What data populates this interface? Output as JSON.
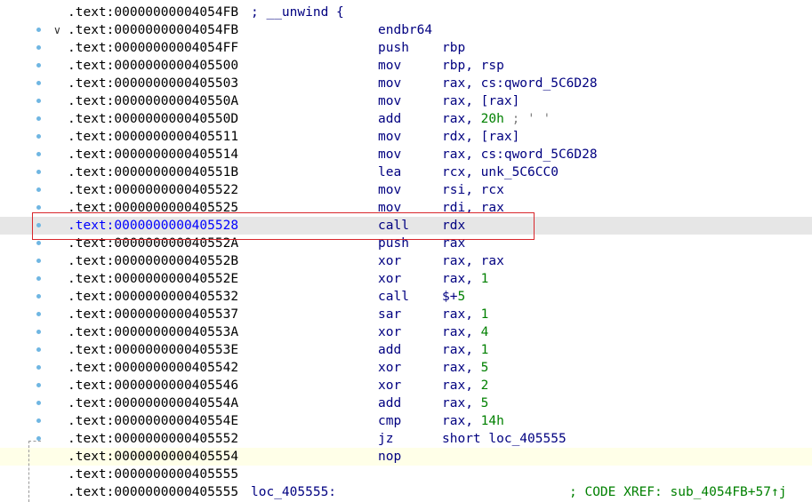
{
  "header_line": {
    "address": ".text:00000000004054FB",
    "comment": "; __unwind {"
  },
  "lines": [
    {
      "address": ".text:00000000004054FB",
      "mnemonic": "endbr64",
      "operands": [],
      "fold": "v",
      "bp": true
    },
    {
      "address": ".text:00000000004054FF",
      "mnemonic": "push",
      "operands": [
        {
          "t": "reg",
          "v": "rbp"
        }
      ],
      "bp": true
    },
    {
      "address": ".text:0000000000405500",
      "mnemonic": "mov",
      "operands": [
        {
          "t": "reg",
          "v": "rbp, rsp"
        }
      ],
      "bp": true
    },
    {
      "address": ".text:0000000000405503",
      "mnemonic": "mov",
      "operands": [
        {
          "t": "reg",
          "v": "rax, cs:qword_5C6D28"
        }
      ],
      "bp": true
    },
    {
      "address": ".text:000000000040550A",
      "mnemonic": "mov",
      "operands": [
        {
          "t": "reg",
          "v": "rax, [rax]"
        }
      ],
      "bp": true
    },
    {
      "address": ".text:000000000040550D",
      "mnemonic": "add",
      "operands": [
        {
          "t": "reg",
          "v": "rax, "
        },
        {
          "t": "num",
          "v": "20h"
        },
        {
          "t": "cmt",
          "v": " ; ' '"
        }
      ],
      "bp": true
    },
    {
      "address": ".text:0000000000405511",
      "mnemonic": "mov",
      "operands": [
        {
          "t": "reg",
          "v": "rdx, [rax]"
        }
      ],
      "bp": true
    },
    {
      "address": ".text:0000000000405514",
      "mnemonic": "mov",
      "operands": [
        {
          "t": "reg",
          "v": "rax, cs:qword_5C6D28"
        }
      ],
      "bp": true
    },
    {
      "address": ".text:000000000040551B",
      "mnemonic": "lea",
      "operands": [
        {
          "t": "reg",
          "v": "rcx, unk_5C6CC0"
        }
      ],
      "bp": true
    },
    {
      "address": ".text:0000000000405522",
      "mnemonic": "mov",
      "operands": [
        {
          "t": "reg",
          "v": "rsi, rcx"
        }
      ],
      "bp": true
    },
    {
      "address": ".text:0000000000405525",
      "mnemonic": "mov",
      "operands": [
        {
          "t": "reg",
          "v": "rdi, rax"
        }
      ],
      "bp": true
    },
    {
      "address": ".text:0000000000405528",
      "mnemonic": "call",
      "operands": [
        {
          "t": "reg",
          "v": "rdx"
        }
      ],
      "bp": true,
      "current": true
    },
    {
      "address": ".text:000000000040552A",
      "mnemonic": "push",
      "operands": [
        {
          "t": "reg",
          "v": "rax"
        }
      ],
      "bp": true
    },
    {
      "address": ".text:000000000040552B",
      "mnemonic": "xor",
      "operands": [
        {
          "t": "reg",
          "v": "rax, rax"
        }
      ],
      "bp": true
    },
    {
      "address": ".text:000000000040552E",
      "mnemonic": "xor",
      "operands": [
        {
          "t": "reg",
          "v": "rax, "
        },
        {
          "t": "num",
          "v": "1"
        }
      ],
      "bp": true
    },
    {
      "address": ".text:0000000000405532",
      "mnemonic": "call",
      "operands": [
        {
          "t": "reg",
          "v": "$+"
        },
        {
          "t": "num",
          "v": "5"
        }
      ],
      "bp": true
    },
    {
      "address": ".text:0000000000405537",
      "mnemonic": "sar",
      "operands": [
        {
          "t": "reg",
          "v": "rax, "
        },
        {
          "t": "num",
          "v": "1"
        }
      ],
      "bp": true
    },
    {
      "address": ".text:000000000040553A",
      "mnemonic": "xor",
      "operands": [
        {
          "t": "reg",
          "v": "rax, "
        },
        {
          "t": "num",
          "v": "4"
        }
      ],
      "bp": true
    },
    {
      "address": ".text:000000000040553E",
      "mnemonic": "add",
      "operands": [
        {
          "t": "reg",
          "v": "rax, "
        },
        {
          "t": "num",
          "v": "1"
        }
      ],
      "bp": true
    },
    {
      "address": ".text:0000000000405542",
      "mnemonic": "xor",
      "operands": [
        {
          "t": "reg",
          "v": "rax, "
        },
        {
          "t": "num",
          "v": "5"
        }
      ],
      "bp": true
    },
    {
      "address": ".text:0000000000405546",
      "mnemonic": "xor",
      "operands": [
        {
          "t": "reg",
          "v": "rax, "
        },
        {
          "t": "num",
          "v": "2"
        }
      ],
      "bp": true
    },
    {
      "address": ".text:000000000040554A",
      "mnemonic": "add",
      "operands": [
        {
          "t": "reg",
          "v": "rax, "
        },
        {
          "t": "num",
          "v": "5"
        }
      ],
      "bp": true
    },
    {
      "address": ".text:000000000040554E",
      "mnemonic": "cmp",
      "operands": [
        {
          "t": "reg",
          "v": "rax, "
        },
        {
          "t": "num",
          "v": "14h"
        }
      ],
      "bp": true
    },
    {
      "address": ".text:0000000000405552",
      "mnemonic": "jz",
      "operands": [
        {
          "t": "reg",
          "v": "short loc_405555"
        }
      ],
      "bp": true
    },
    {
      "address": ".text:0000000000405554",
      "mnemonic": "nop",
      "operands": [],
      "bp": false,
      "yellow": true
    },
    {
      "address": ".text:0000000000405555",
      "mnemonic": "",
      "operands": [],
      "bp": false
    },
    {
      "address": ".text:0000000000405555",
      "label": "loc_405555:",
      "mnemonic": "",
      "operands": [],
      "bp": false,
      "xref": "; CODE XREF: sub_4054FB+57↑j"
    }
  ],
  "colors": {
    "highlight_box": "#d9262b",
    "current_line_bg": "#e6e6e6",
    "address_current": "#0000ff",
    "instruction": "#000080",
    "number": "#008000",
    "breakpoint_dot": "#6fb6e2"
  }
}
